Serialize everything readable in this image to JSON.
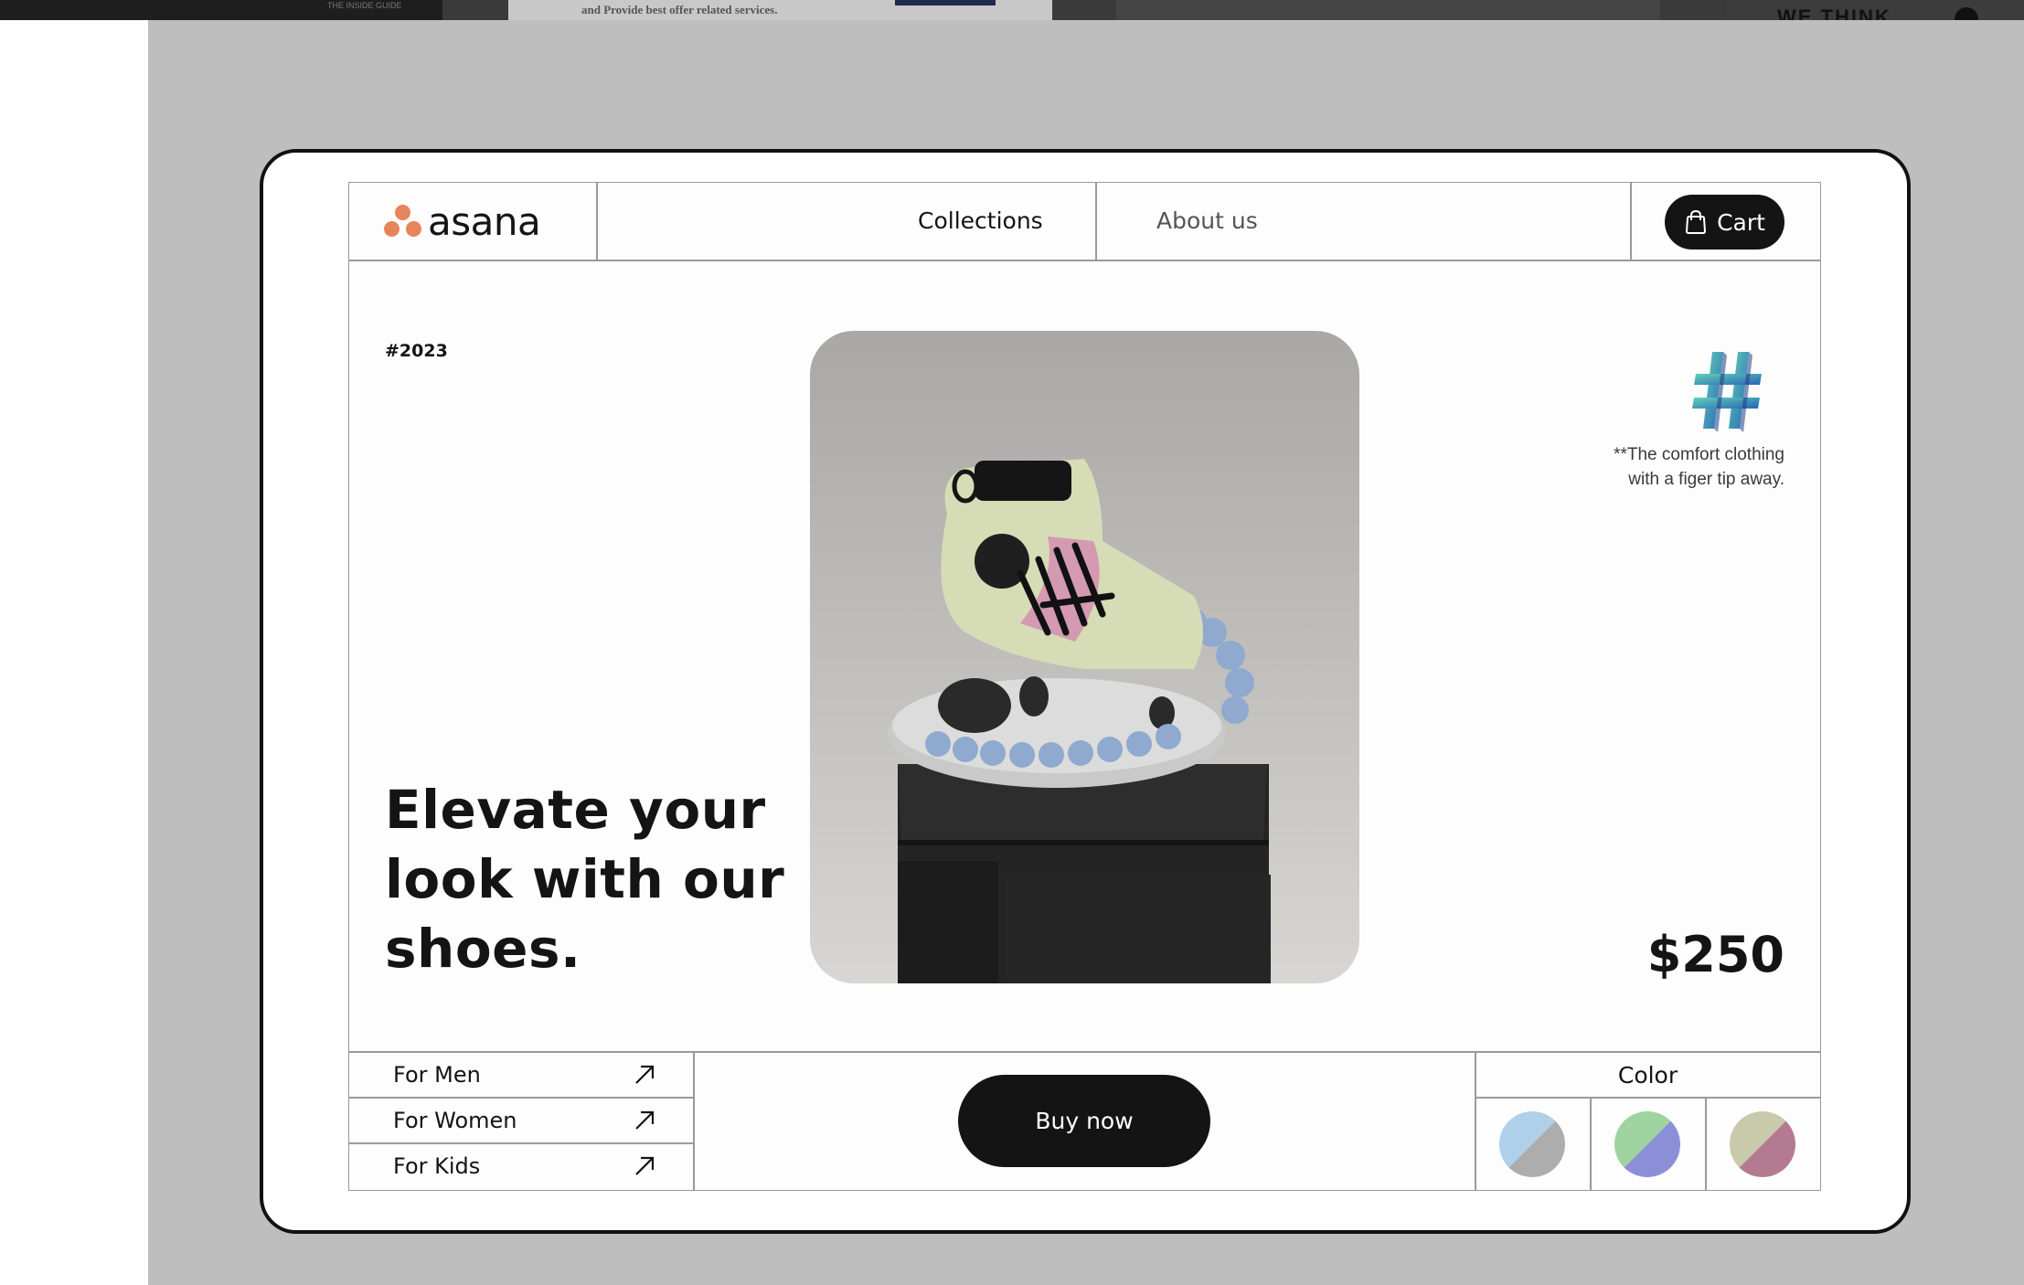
{
  "background_page": {
    "snippet_left": "THE INSIDE GUIDE",
    "snippet_middle": "and Provide best offer related services.",
    "snippet_right": "WE THINK"
  },
  "header": {
    "logo_text": "asana",
    "logo_color": "#e8845c",
    "nav": [
      "Collections",
      "About us"
    ],
    "cart_label": "Cart",
    "cart_icon": "shopping-bag-icon"
  },
  "hero": {
    "tag": "#2023",
    "headline": "Elevate your look with our shoes.",
    "product_image": "sneaker-on-black-stone-pedestal",
    "deco_icon": "3d-hash-symbol-icon",
    "note": "**The comfort clothing\nwith  a figer tip away.",
    "price": "$250"
  },
  "categories": [
    {
      "label": "For Men",
      "icon": "arrow-up-right-icon"
    },
    {
      "label": "For Women",
      "icon": "arrow-up-right-icon"
    },
    {
      "label": "For Kids",
      "icon": "arrow-up-right-icon"
    }
  ],
  "buy_label": "Buy now",
  "color": {
    "label": "Color",
    "options": [
      {
        "top": "#b0cfe8",
        "bottom": "#adadad"
      },
      {
        "top": "#9fd39f",
        "bottom": "#8c8fd8"
      },
      {
        "top": "#c9c9ab",
        "bottom": "#b47b90"
      }
    ]
  },
  "theme": {
    "dark": "#141414",
    "border": "#9a9a9a",
    "page_backdrop": "#bebebe"
  }
}
